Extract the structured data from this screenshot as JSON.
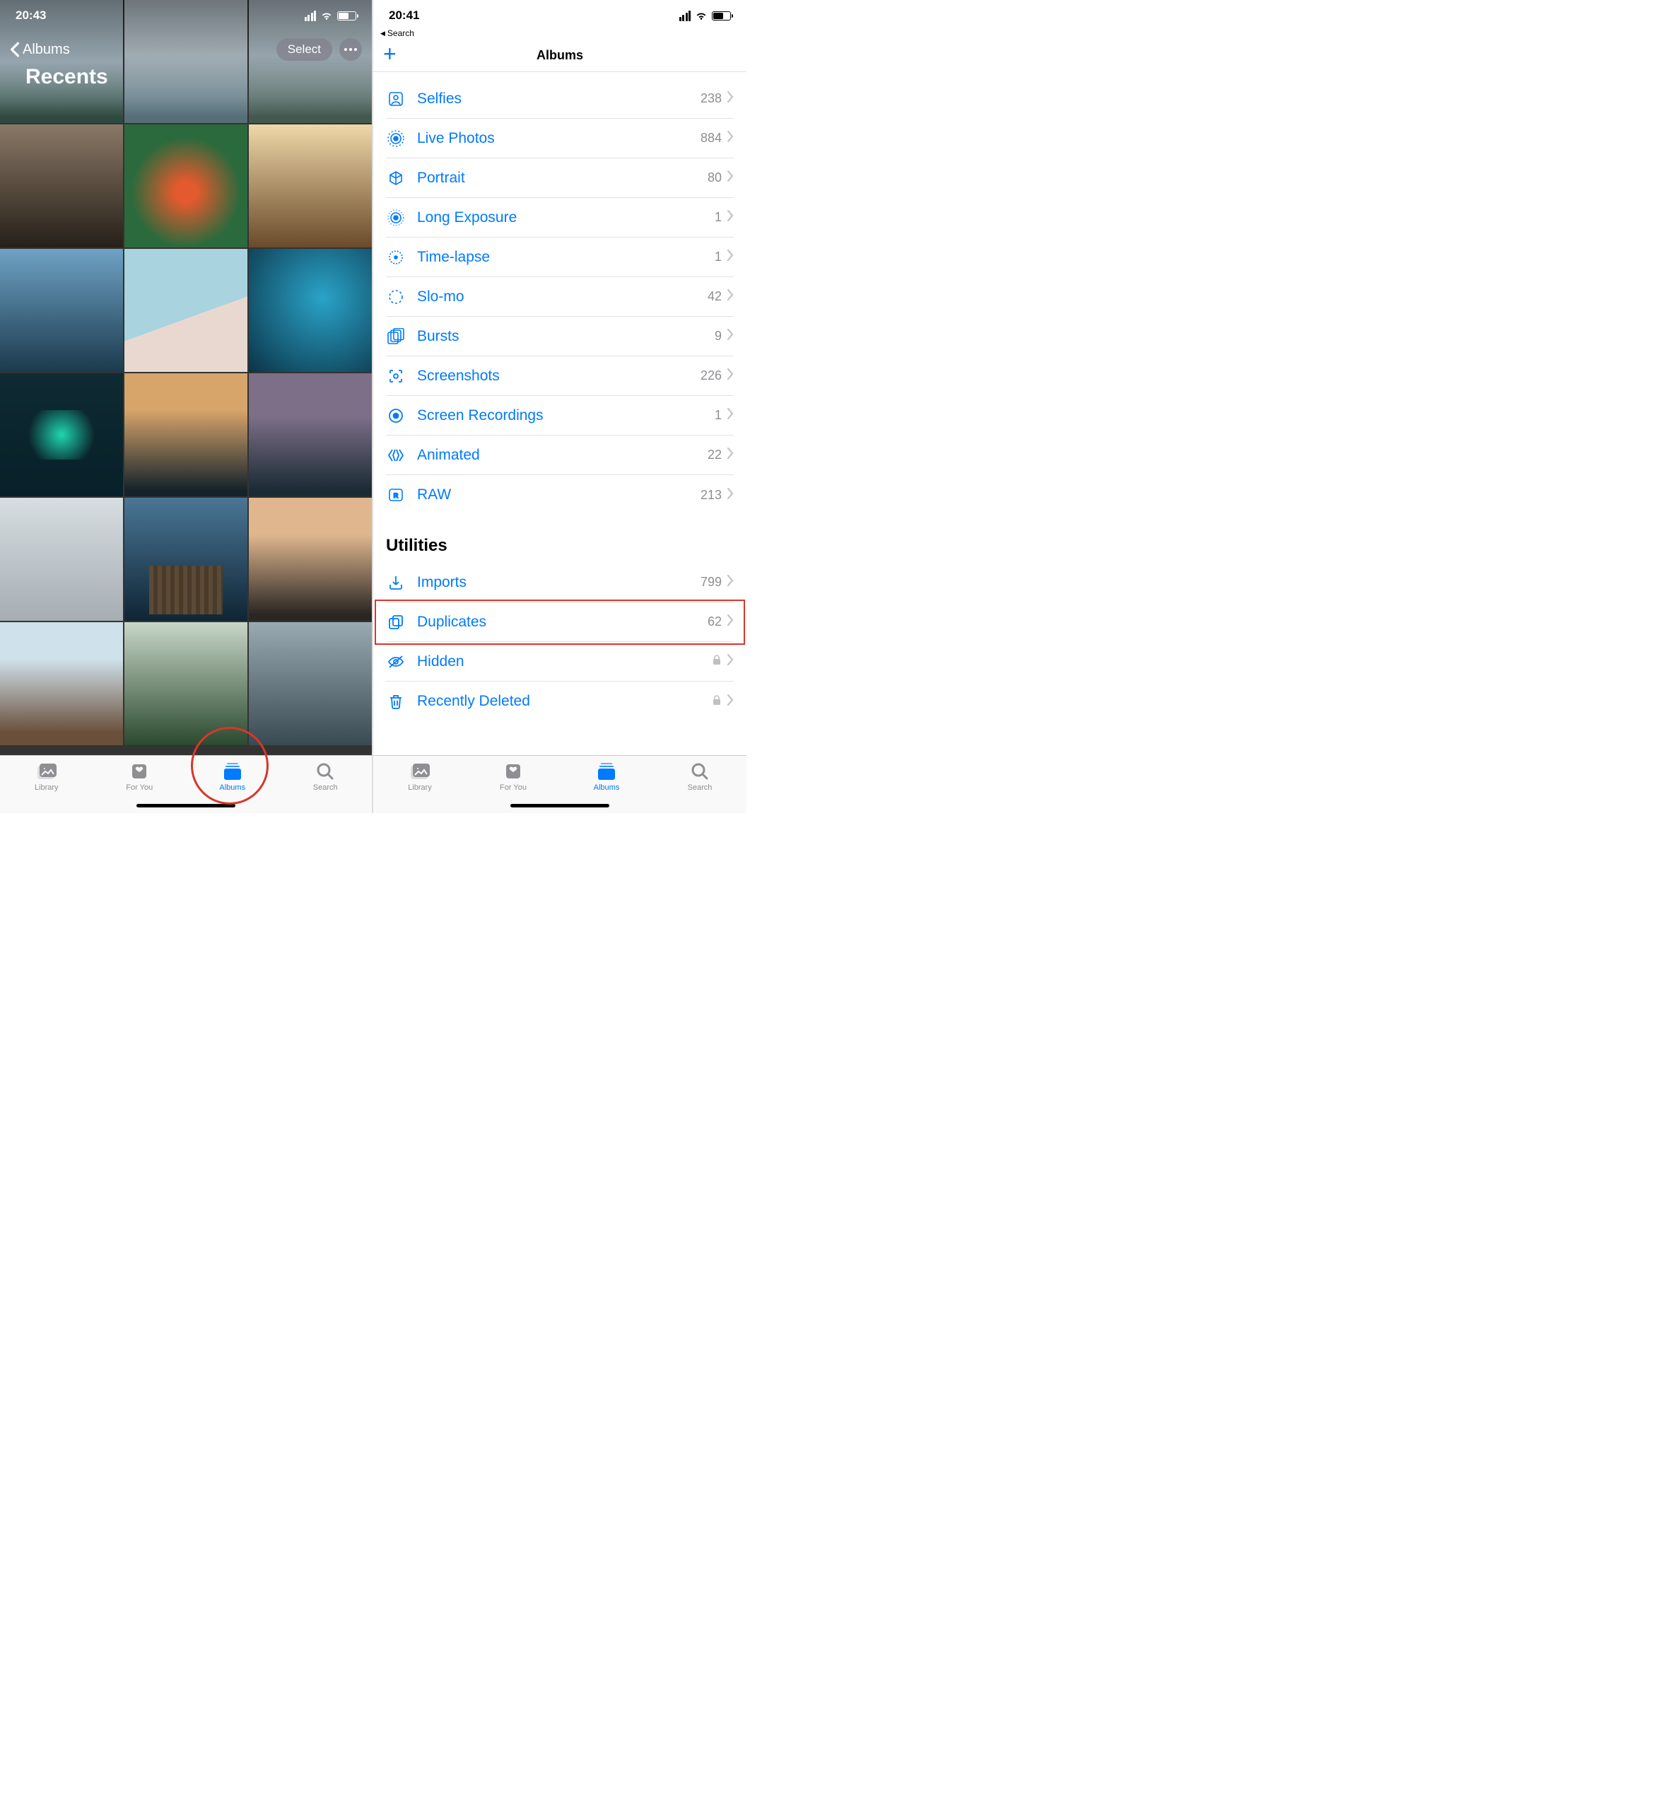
{
  "left": {
    "status_time": "20:43",
    "back_label": "Albums",
    "title": "Recents",
    "select_btn": "Select",
    "tabs": {
      "library": "Library",
      "foryou": "For You",
      "albums": "Albums",
      "search": "Search"
    }
  },
  "right": {
    "status_time": "20:41",
    "back_to": "Search",
    "header_title": "Albums",
    "media_types": [
      {
        "icon": "selfies",
        "label": "Selfies",
        "count": "238"
      },
      {
        "icon": "live",
        "label": "Live Photos",
        "count": "884"
      },
      {
        "icon": "portrait",
        "label": "Portrait",
        "count": "80"
      },
      {
        "icon": "longexp",
        "label": "Long Exposure",
        "count": "1"
      },
      {
        "icon": "timelapse",
        "label": "Time-lapse",
        "count": "1"
      },
      {
        "icon": "slomo",
        "label": "Slo-mo",
        "count": "42"
      },
      {
        "icon": "bursts",
        "label": "Bursts",
        "count": "9"
      },
      {
        "icon": "screenshots",
        "label": "Screenshots",
        "count": "226"
      },
      {
        "icon": "screenrec",
        "label": "Screen Recordings",
        "count": "1"
      },
      {
        "icon": "animated",
        "label": "Animated",
        "count": "22"
      },
      {
        "icon": "raw",
        "label": "RAW",
        "count": "213"
      }
    ],
    "utilities_header": "Utilities",
    "utilities": [
      {
        "icon": "imports",
        "label": "Imports",
        "count": "799",
        "lock": false
      },
      {
        "icon": "duplicates",
        "label": "Duplicates",
        "count": "62",
        "lock": false
      },
      {
        "icon": "hidden",
        "label": "Hidden",
        "count": "",
        "lock": true
      },
      {
        "icon": "deleted",
        "label": "Recently Deleted",
        "count": "",
        "lock": true
      }
    ],
    "tabs": {
      "library": "Library",
      "foryou": "For You",
      "albums": "Albums",
      "search": "Search"
    }
  }
}
